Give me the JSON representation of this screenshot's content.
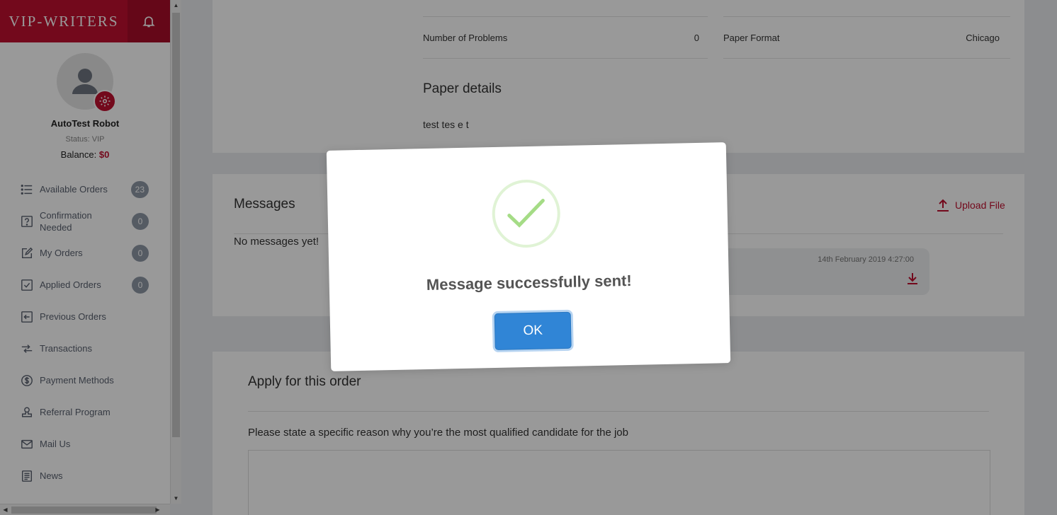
{
  "brand": {
    "logo_text": "VIP-WRITERS"
  },
  "user": {
    "name": "AutoTest Robot",
    "status": "Status: VIP",
    "balance_label": "Balance:",
    "balance_value": "$0"
  },
  "nav": [
    {
      "label": "Available Orders",
      "icon": "list-icon",
      "badge": "23"
    },
    {
      "label": "Confirmation Needed",
      "icon": "question-icon",
      "badge": "0"
    },
    {
      "label": "My Orders",
      "icon": "edit-icon",
      "badge": "0"
    },
    {
      "label": "Applied Orders",
      "icon": "check-square-icon",
      "badge": "0"
    },
    {
      "label": "Previous Orders",
      "icon": "arrow-left-box-icon",
      "badge": ""
    },
    {
      "label": "Transactions",
      "icon": "transfer-icon",
      "badge": ""
    },
    {
      "label": "Payment Methods",
      "icon": "dollar-circle-icon",
      "badge": ""
    },
    {
      "label": "Referral Program",
      "icon": "stamp-icon",
      "badge": ""
    },
    {
      "label": "Mail Us",
      "icon": "mail-icon",
      "badge": ""
    },
    {
      "label": "News",
      "icon": "news-icon",
      "badge": ""
    }
  ],
  "details": {
    "number_of_problems_label": "Number of Problems",
    "number_of_problems_value": "0",
    "paper_format_label": "Paper Format",
    "paper_format_value": "Chicago"
  },
  "paper_details": {
    "title": "Paper details",
    "text": "test tes e t"
  },
  "messages": {
    "title": "Messages",
    "upload_label": "Upload File",
    "empty_text": "No messages yet!",
    "attachment_date": "14th February 2019 4:27:00"
  },
  "apply": {
    "title": "Apply for this order",
    "prompt": "Please state a specific reason why you’re the most qualified candidate for the job"
  },
  "modal": {
    "title": "Message successfully sent!",
    "ok_label": "OK"
  },
  "colors": {
    "brand": "#c0102f",
    "accent": "#3085d6",
    "success": "#a5dc86"
  }
}
